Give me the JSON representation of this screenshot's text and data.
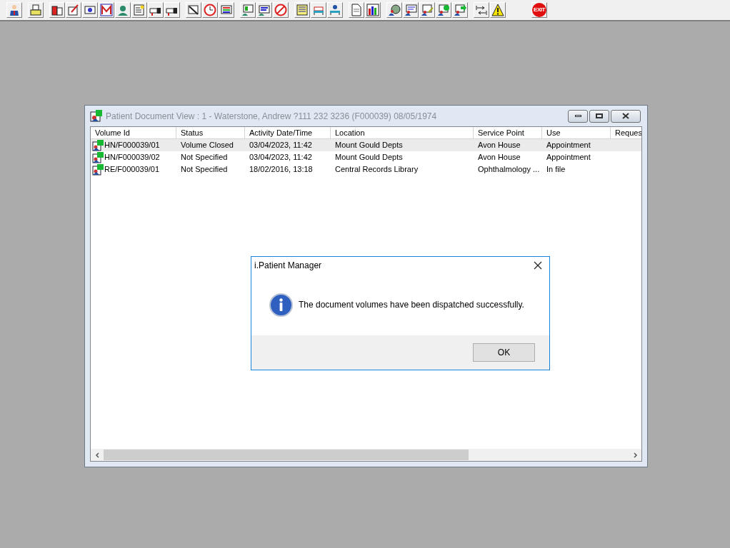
{
  "toolbar": {
    "exit_label": "EXIT"
  },
  "window": {
    "title": "Patient Document View : 1 - Waterstone, Andrew ?111 232 3236 (F000039) 08/05/1974"
  },
  "table": {
    "columns": [
      "Volume Id",
      "Status",
      "Activity Date/Time",
      "Location",
      "Service Point",
      "Use",
      "Reques"
    ],
    "rows": [
      {
        "selected": true,
        "cells": [
          "HN/F000039/01",
          "Volume Closed",
          "03/04/2023, 11:42",
          "Mount Gould Depts",
          "Avon House",
          "Appointment"
        ]
      },
      {
        "selected": false,
        "cells": [
          "HN/F000039/02",
          "Not Specified",
          "03/04/2023, 11:42",
          "Mount Gould Depts",
          "Avon House",
          "Appointment"
        ]
      },
      {
        "selected": false,
        "cells": [
          "RE/F000039/01",
          "Not Specified",
          "18/02/2016, 13:18",
          "Central Records Library",
          "Ophthalmology ...",
          "In file"
        ]
      }
    ]
  },
  "dialog": {
    "title": "i.Patient Manager",
    "message": "The document volumes have been dispatched successfully.",
    "buttons": [
      "OK"
    ]
  }
}
